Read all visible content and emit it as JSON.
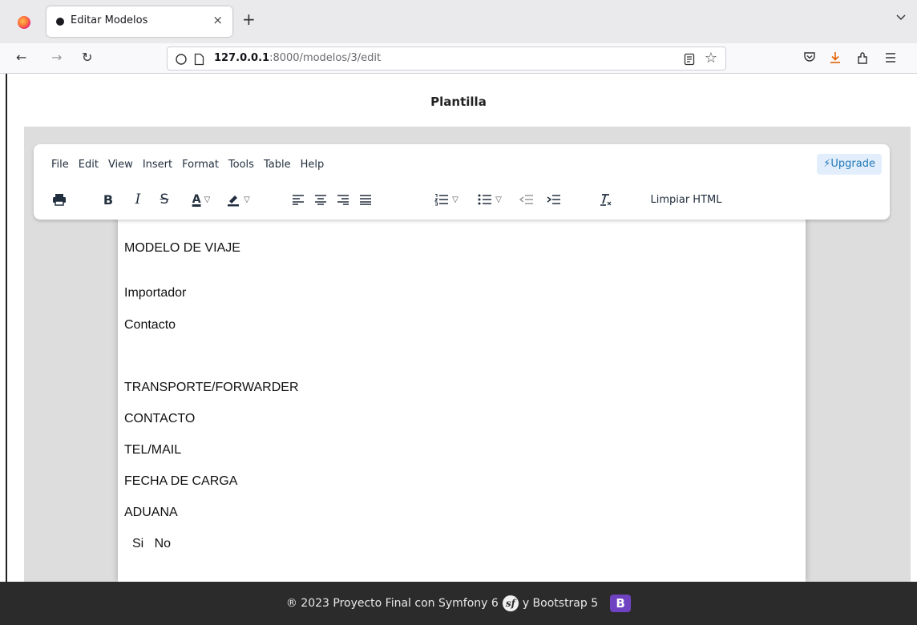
{
  "browser": {
    "tab_title": "Editar Modelos",
    "tab_close": "×",
    "new_tab": "+",
    "url_host": "127.0.0.1",
    "url_rest": ":8000/modelos/3/edit"
  },
  "page": {
    "title": "Plantilla"
  },
  "editor": {
    "menu": [
      "File",
      "Edit",
      "View",
      "Insert",
      "Format",
      "Tools",
      "Table",
      "Help"
    ],
    "upgrade_label": "⚡Upgrade",
    "toolbar": {
      "bold": "B",
      "italic": "I",
      "strike": "S",
      "font_color": "A",
      "clean_html_label": "Limpiar HTML"
    },
    "icons": [
      "print-icon",
      "bold-icon",
      "italic-icon",
      "strikethrough-icon",
      "font-color-icon",
      "highlight-icon",
      "align-left-icon",
      "align-center-icon",
      "align-right-icon",
      "align-justify-icon",
      "numbered-list-icon",
      "bullet-list-icon",
      "outdent-icon",
      "indent-icon",
      "clear-formatting-icon"
    ],
    "content": [
      "MODELO DE VIAJE",
      "Importador",
      "Contacto",
      "TRANSPORTE/FORWARDER",
      "CONTACTO",
      "TEL/MAIL",
      "FECHA DE CARGA",
      "ADUANA",
      "Si   No"
    ]
  },
  "footer": {
    "text_before": "® 2023 Proyecto Final con Symfony 6",
    "symfony_logo": "sf",
    "text_after": "y Bootstrap 5",
    "bootstrap_logo": "B"
  },
  "colors": {
    "accent_upgrade": "#207ab7",
    "footer_bg": "#2b2b2b",
    "bootstrap_purple": "#6f42c1",
    "download_orange": "#e66000"
  }
}
